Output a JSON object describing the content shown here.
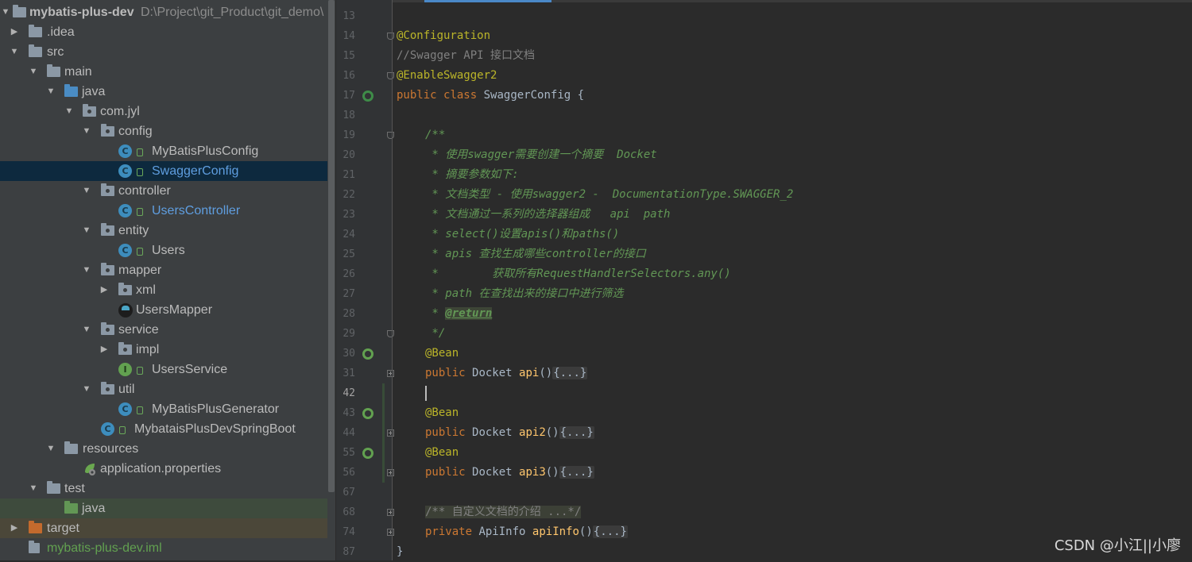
{
  "project_tree": {
    "root_name": "mybatis-plus-dev",
    "root_path": "D:\\Project\\git_Product\\git_demo\\",
    "items": [
      {
        "label": ".idea"
      },
      {
        "label": "src"
      },
      {
        "label": "main"
      },
      {
        "label": "java"
      },
      {
        "label": "com.jyl"
      },
      {
        "label": "config"
      },
      {
        "label": "MyBatisPlusConfig"
      },
      {
        "label": "SwaggerConfig"
      },
      {
        "label": "controller"
      },
      {
        "label": "UsersController"
      },
      {
        "label": "entity"
      },
      {
        "label": "Users"
      },
      {
        "label": "mapper"
      },
      {
        "label": "xml"
      },
      {
        "label": "UsersMapper"
      },
      {
        "label": "service"
      },
      {
        "label": "impl"
      },
      {
        "label": "UsersService"
      },
      {
        "label": "util"
      },
      {
        "label": "MyBatisPlusGenerator"
      },
      {
        "label": "MybataisPlusDevSpringBoot"
      },
      {
        "label": "resources"
      },
      {
        "label": "application.properties"
      },
      {
        "label": "test"
      },
      {
        "label": "java"
      },
      {
        "label": "target"
      },
      {
        "label": "mybatis-plus-dev.iml"
      }
    ],
    "icons": {
      "class": "C",
      "interface": "I"
    }
  },
  "editor": {
    "line_numbers": [
      "13",
      "14",
      "15",
      "16",
      "17",
      "18",
      "19",
      "20",
      "21",
      "22",
      "23",
      "24",
      "25",
      "26",
      "27",
      "28",
      "29",
      "30",
      "31",
      "42",
      "43",
      "44",
      "55",
      "56",
      "67",
      "68",
      "74",
      "87"
    ],
    "current_line": "42",
    "tokens": {
      "configuration": "@Configuration",
      "comment_swagger": "//Swagger API 接口文档",
      "enable_swagger": "@EnableSwagger2",
      "public": "public",
      "class": "class",
      "class_name": "SwaggerConfig {",
      "doc_open": "/**",
      "doc1": " * 使用swagger需要创建一个摘要  Docket",
      "doc2": " * 摘要参数如下:",
      "doc3": " * 文档类型 - 使用swagger2 -  DocumentationType.SWAGGER_2",
      "doc4": " * 文档通过一系列的选择器组成   api  path",
      "doc5": " * select()设置apis()和paths()",
      "doc6": " * apis 查找生成哪些controller的接口",
      "doc7": " *        获取所有RequestHandlerSelectors.any()",
      "doc8": " * path 在查找出来的接口中进行筛选",
      "doc9_star": " * ",
      "doc9_tag": "@return",
      "doc_close": " */",
      "bean": "@Bean",
      "docket_type": "Docket",
      "api": "api",
      "api2": "api2",
      "api3": "api3",
      "parens": "()",
      "folded": "{...}",
      "private": "private",
      "apiinfo_type": "ApiInfo",
      "apiinfo": "apiInfo",
      "folded_comment": "/** 自定义文档的介绍 ...*/",
      "close_brace": "}"
    }
  },
  "watermark": "CSDN @小江||小廖",
  "colors": {
    "tree_bg": "#3c3f41",
    "editor_bg": "#2b2b2b",
    "keyword": "#cc7832",
    "annotation": "#bbb529",
    "doc_comment": "#629755",
    "function": "#ffc66d",
    "selection": "#0d293e"
  }
}
